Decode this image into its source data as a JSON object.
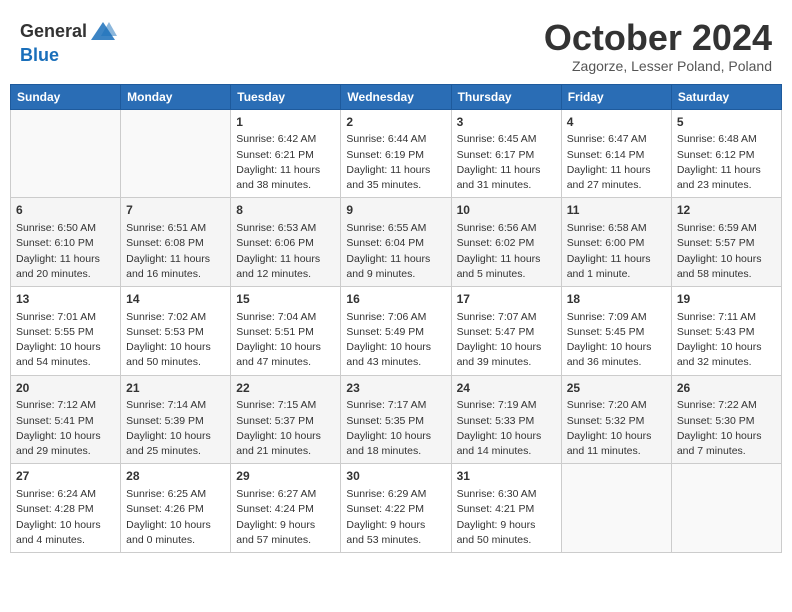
{
  "header": {
    "logo_general": "General",
    "logo_blue": "Blue",
    "month_title": "October 2024",
    "subtitle": "Zagorze, Lesser Poland, Poland"
  },
  "calendar": {
    "days_of_week": [
      "Sunday",
      "Monday",
      "Tuesday",
      "Wednesday",
      "Thursday",
      "Friday",
      "Saturday"
    ],
    "weeks": [
      [
        {
          "day": "",
          "info": ""
        },
        {
          "day": "",
          "info": ""
        },
        {
          "day": "1",
          "info": "Sunrise: 6:42 AM\nSunset: 6:21 PM\nDaylight: 11 hours and 38 minutes."
        },
        {
          "day": "2",
          "info": "Sunrise: 6:44 AM\nSunset: 6:19 PM\nDaylight: 11 hours and 35 minutes."
        },
        {
          "day": "3",
          "info": "Sunrise: 6:45 AM\nSunset: 6:17 PM\nDaylight: 11 hours and 31 minutes."
        },
        {
          "day": "4",
          "info": "Sunrise: 6:47 AM\nSunset: 6:14 PM\nDaylight: 11 hours and 27 minutes."
        },
        {
          "day": "5",
          "info": "Sunrise: 6:48 AM\nSunset: 6:12 PM\nDaylight: 11 hours and 23 minutes."
        }
      ],
      [
        {
          "day": "6",
          "info": "Sunrise: 6:50 AM\nSunset: 6:10 PM\nDaylight: 11 hours and 20 minutes."
        },
        {
          "day": "7",
          "info": "Sunrise: 6:51 AM\nSunset: 6:08 PM\nDaylight: 11 hours and 16 minutes."
        },
        {
          "day": "8",
          "info": "Sunrise: 6:53 AM\nSunset: 6:06 PM\nDaylight: 11 hours and 12 minutes."
        },
        {
          "day": "9",
          "info": "Sunrise: 6:55 AM\nSunset: 6:04 PM\nDaylight: 11 hours and 9 minutes."
        },
        {
          "day": "10",
          "info": "Sunrise: 6:56 AM\nSunset: 6:02 PM\nDaylight: 11 hours and 5 minutes."
        },
        {
          "day": "11",
          "info": "Sunrise: 6:58 AM\nSunset: 6:00 PM\nDaylight: 11 hours and 1 minute."
        },
        {
          "day": "12",
          "info": "Sunrise: 6:59 AM\nSunset: 5:57 PM\nDaylight: 10 hours and 58 minutes."
        }
      ],
      [
        {
          "day": "13",
          "info": "Sunrise: 7:01 AM\nSunset: 5:55 PM\nDaylight: 10 hours and 54 minutes."
        },
        {
          "day": "14",
          "info": "Sunrise: 7:02 AM\nSunset: 5:53 PM\nDaylight: 10 hours and 50 minutes."
        },
        {
          "day": "15",
          "info": "Sunrise: 7:04 AM\nSunset: 5:51 PM\nDaylight: 10 hours and 47 minutes."
        },
        {
          "day": "16",
          "info": "Sunrise: 7:06 AM\nSunset: 5:49 PM\nDaylight: 10 hours and 43 minutes."
        },
        {
          "day": "17",
          "info": "Sunrise: 7:07 AM\nSunset: 5:47 PM\nDaylight: 10 hours and 39 minutes."
        },
        {
          "day": "18",
          "info": "Sunrise: 7:09 AM\nSunset: 5:45 PM\nDaylight: 10 hours and 36 minutes."
        },
        {
          "day": "19",
          "info": "Sunrise: 7:11 AM\nSunset: 5:43 PM\nDaylight: 10 hours and 32 minutes."
        }
      ],
      [
        {
          "day": "20",
          "info": "Sunrise: 7:12 AM\nSunset: 5:41 PM\nDaylight: 10 hours and 29 minutes."
        },
        {
          "day": "21",
          "info": "Sunrise: 7:14 AM\nSunset: 5:39 PM\nDaylight: 10 hours and 25 minutes."
        },
        {
          "day": "22",
          "info": "Sunrise: 7:15 AM\nSunset: 5:37 PM\nDaylight: 10 hours and 21 minutes."
        },
        {
          "day": "23",
          "info": "Sunrise: 7:17 AM\nSunset: 5:35 PM\nDaylight: 10 hours and 18 minutes."
        },
        {
          "day": "24",
          "info": "Sunrise: 7:19 AM\nSunset: 5:33 PM\nDaylight: 10 hours and 14 minutes."
        },
        {
          "day": "25",
          "info": "Sunrise: 7:20 AM\nSunset: 5:32 PM\nDaylight: 10 hours and 11 minutes."
        },
        {
          "day": "26",
          "info": "Sunrise: 7:22 AM\nSunset: 5:30 PM\nDaylight: 10 hours and 7 minutes."
        }
      ],
      [
        {
          "day": "27",
          "info": "Sunrise: 6:24 AM\nSunset: 4:28 PM\nDaylight: 10 hours and 4 minutes."
        },
        {
          "day": "28",
          "info": "Sunrise: 6:25 AM\nSunset: 4:26 PM\nDaylight: 10 hours and 0 minutes."
        },
        {
          "day": "29",
          "info": "Sunrise: 6:27 AM\nSunset: 4:24 PM\nDaylight: 9 hours and 57 minutes."
        },
        {
          "day": "30",
          "info": "Sunrise: 6:29 AM\nSunset: 4:22 PM\nDaylight: 9 hours and 53 minutes."
        },
        {
          "day": "31",
          "info": "Sunrise: 6:30 AM\nSunset: 4:21 PM\nDaylight: 9 hours and 50 minutes."
        },
        {
          "day": "",
          "info": ""
        },
        {
          "day": "",
          "info": ""
        }
      ]
    ]
  }
}
